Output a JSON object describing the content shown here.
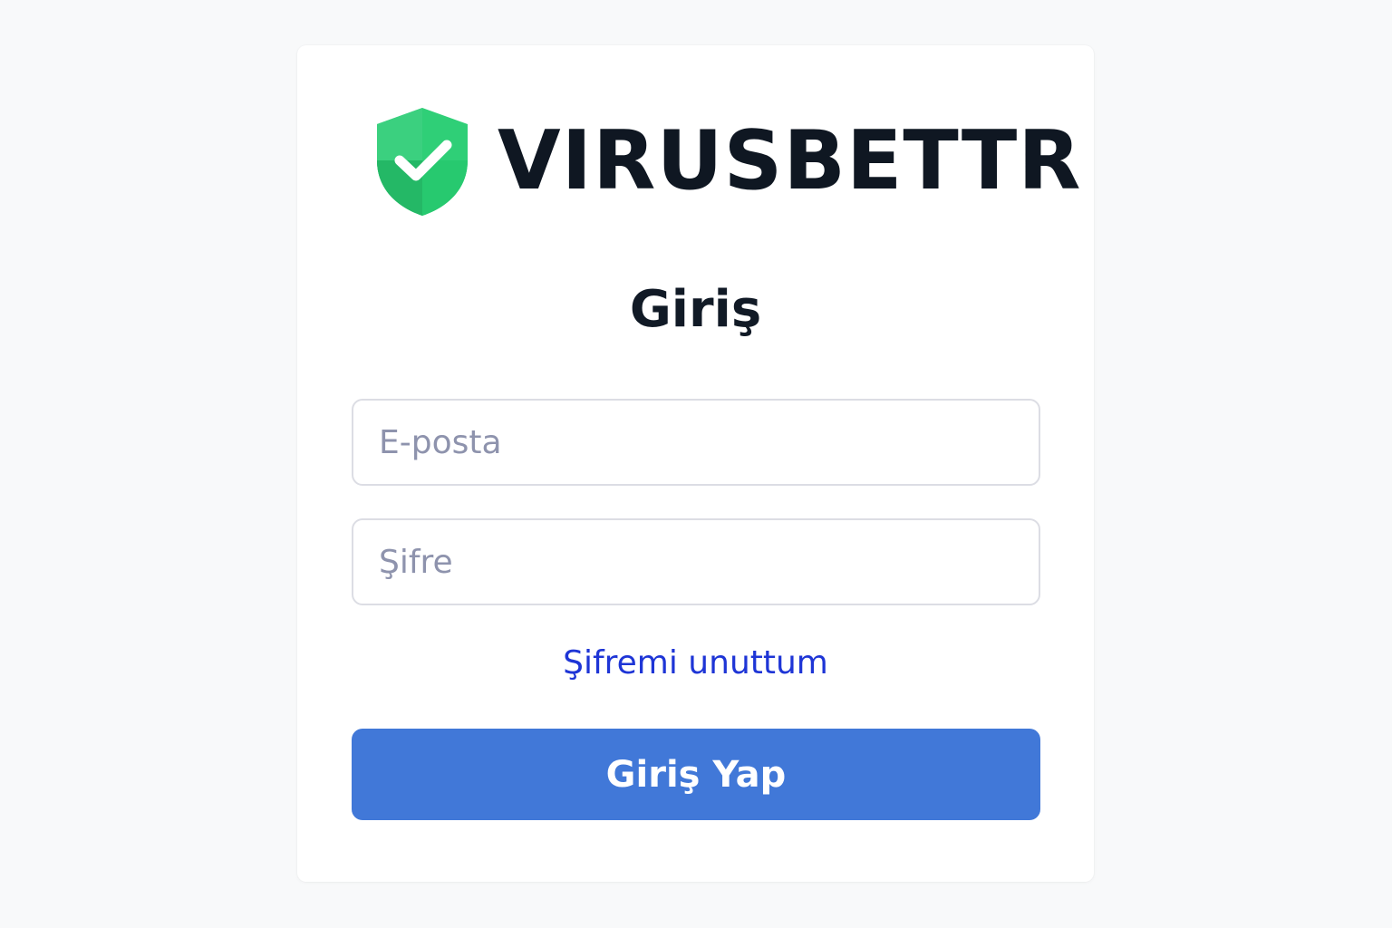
{
  "brand": {
    "name": "VIRUSBETTR",
    "logo_icon": "shield-check-icon",
    "logo_colors": [
      "#3ccf7b",
      "#22b865",
      "#1fa85a"
    ]
  },
  "login": {
    "title": "Giriş",
    "email_placeholder": "E-posta",
    "password_placeholder": "Şifre",
    "forgot_password_label": "Şifremi unuttum",
    "submit_label": "Giriş Yap"
  },
  "colors": {
    "accent": "#4178d8",
    "link": "#1e35d6",
    "text": "#111a26"
  }
}
